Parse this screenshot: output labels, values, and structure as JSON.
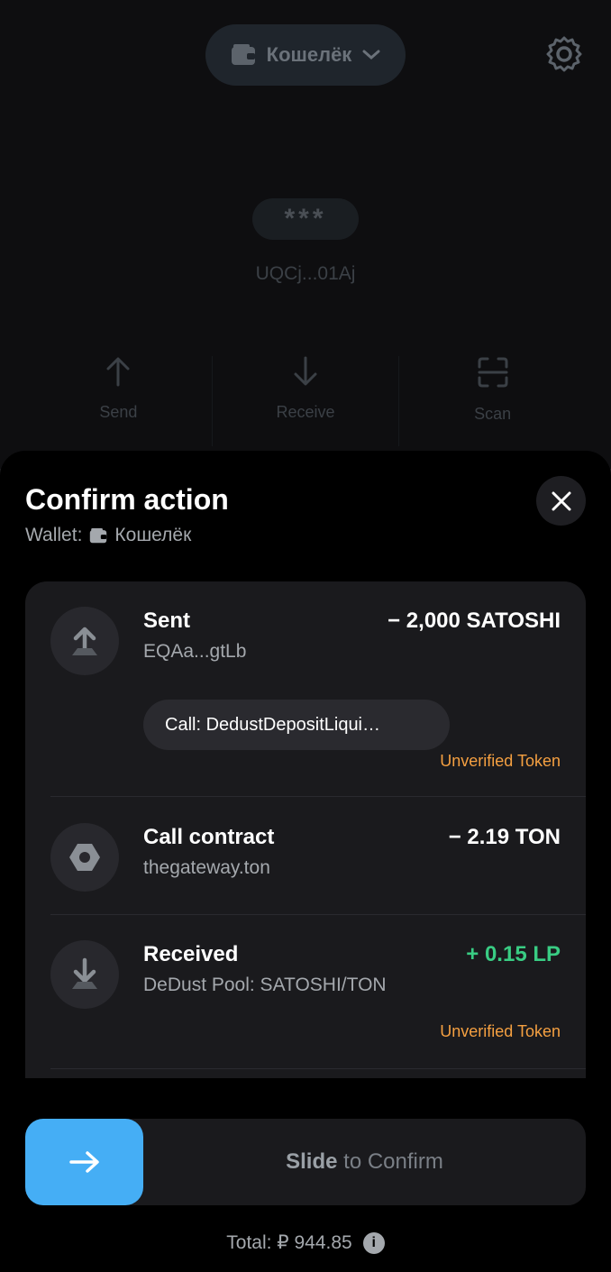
{
  "background": {
    "wallet_label": "Кошелёк",
    "hidden_balance": "***",
    "address": "UQCj...01Aj",
    "actions": [
      {
        "label": "Send"
      },
      {
        "label": "Receive"
      },
      {
        "label": "Scan"
      }
    ]
  },
  "sheet": {
    "title": "Confirm action",
    "wallet_prefix": "Wallet:",
    "wallet_name": "Кошелёк",
    "rows": [
      {
        "title": "Sent",
        "subtitle": "EQAa...gtLb",
        "amount": "− 2,000 SATOSHI",
        "call": "Call: DedustDepositLiqui…",
        "warning": "Unverified Token"
      },
      {
        "title": "Call contract",
        "subtitle": "thegateway.ton",
        "amount": "− 2.19 TON"
      },
      {
        "title": "Received",
        "subtitle": "DeDust Pool: SATOSHI/TON",
        "amount": "+ 0.15 LP",
        "warning": "Unverified Token"
      }
    ]
  },
  "confirm": {
    "slide_strong": "Slide",
    "slide_rest": "to Confirm",
    "total": "Total: ₽ 944.85"
  },
  "colors": {
    "accent": "#45aef5",
    "positive": "#39cc83",
    "warning": "#f5a041"
  }
}
